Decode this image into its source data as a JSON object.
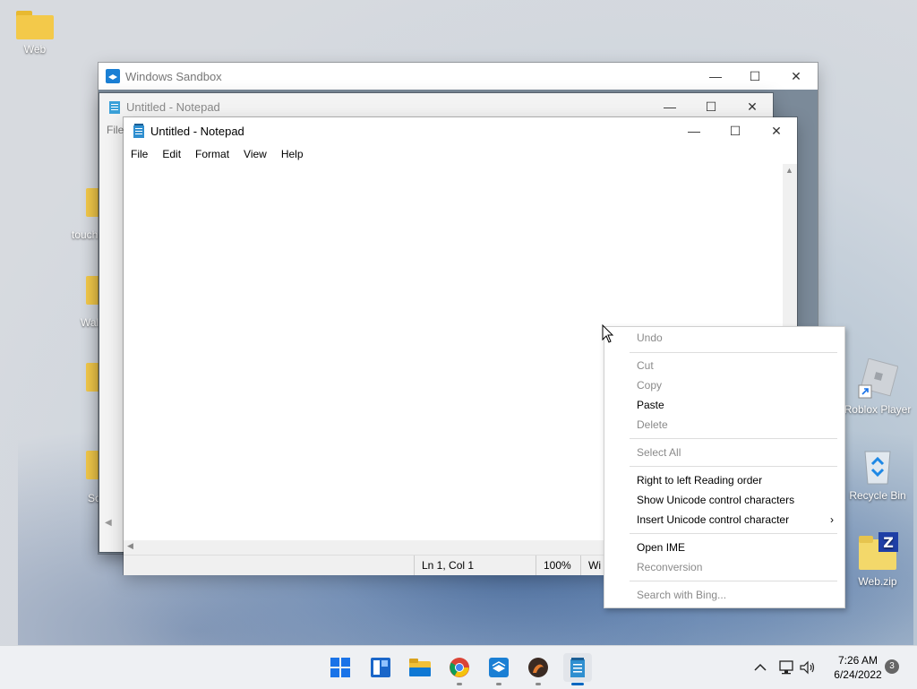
{
  "desktop": {
    "icons": {
      "web": "Web",
      "touch": "touch",
      "wal": "Wal",
      "sc": "Sc",
      "roblox": "Roblox Player",
      "recycle": "Recycle Bin",
      "webzip": "Web.zip"
    }
  },
  "sandbox": {
    "title": "Windows Sandbox"
  },
  "notepad_back": {
    "title": "Untitled - Notepad",
    "menu_peek": "File"
  },
  "notepad": {
    "title": "Untitled - Notepad",
    "menu": [
      "File",
      "Edit",
      "Format",
      "View",
      "Help"
    ],
    "status": {
      "position": "Ln 1, Col 1",
      "zoom": "100%",
      "eol": "Wi"
    }
  },
  "context_menu": {
    "items": [
      {
        "label": "Undo",
        "enabled": false
      },
      {
        "label": "Cut",
        "enabled": false
      },
      {
        "label": "Copy",
        "enabled": false
      },
      {
        "label": "Paste",
        "enabled": true
      },
      {
        "label": "Delete",
        "enabled": false
      },
      {
        "label": "Select All",
        "enabled": false
      },
      {
        "label": "Right to left Reading order",
        "enabled": true
      },
      {
        "label": "Show Unicode control characters",
        "enabled": true
      },
      {
        "label": "Insert Unicode control character",
        "enabled": true,
        "submenu": true
      },
      {
        "label": "Open IME",
        "enabled": true
      },
      {
        "label": "Reconversion",
        "enabled": false
      },
      {
        "label": "Search with Bing...",
        "enabled": false
      }
    ]
  },
  "taskbar": {
    "apps": [
      "start-icon",
      "widgets-icon",
      "file-explorer-icon",
      "chrome-icon",
      "sandbox-icon",
      "app-icon",
      "notepad-icon"
    ],
    "clock": {
      "time": "7:26 AM",
      "date": "6/24/2022"
    },
    "notification_count": "3"
  }
}
